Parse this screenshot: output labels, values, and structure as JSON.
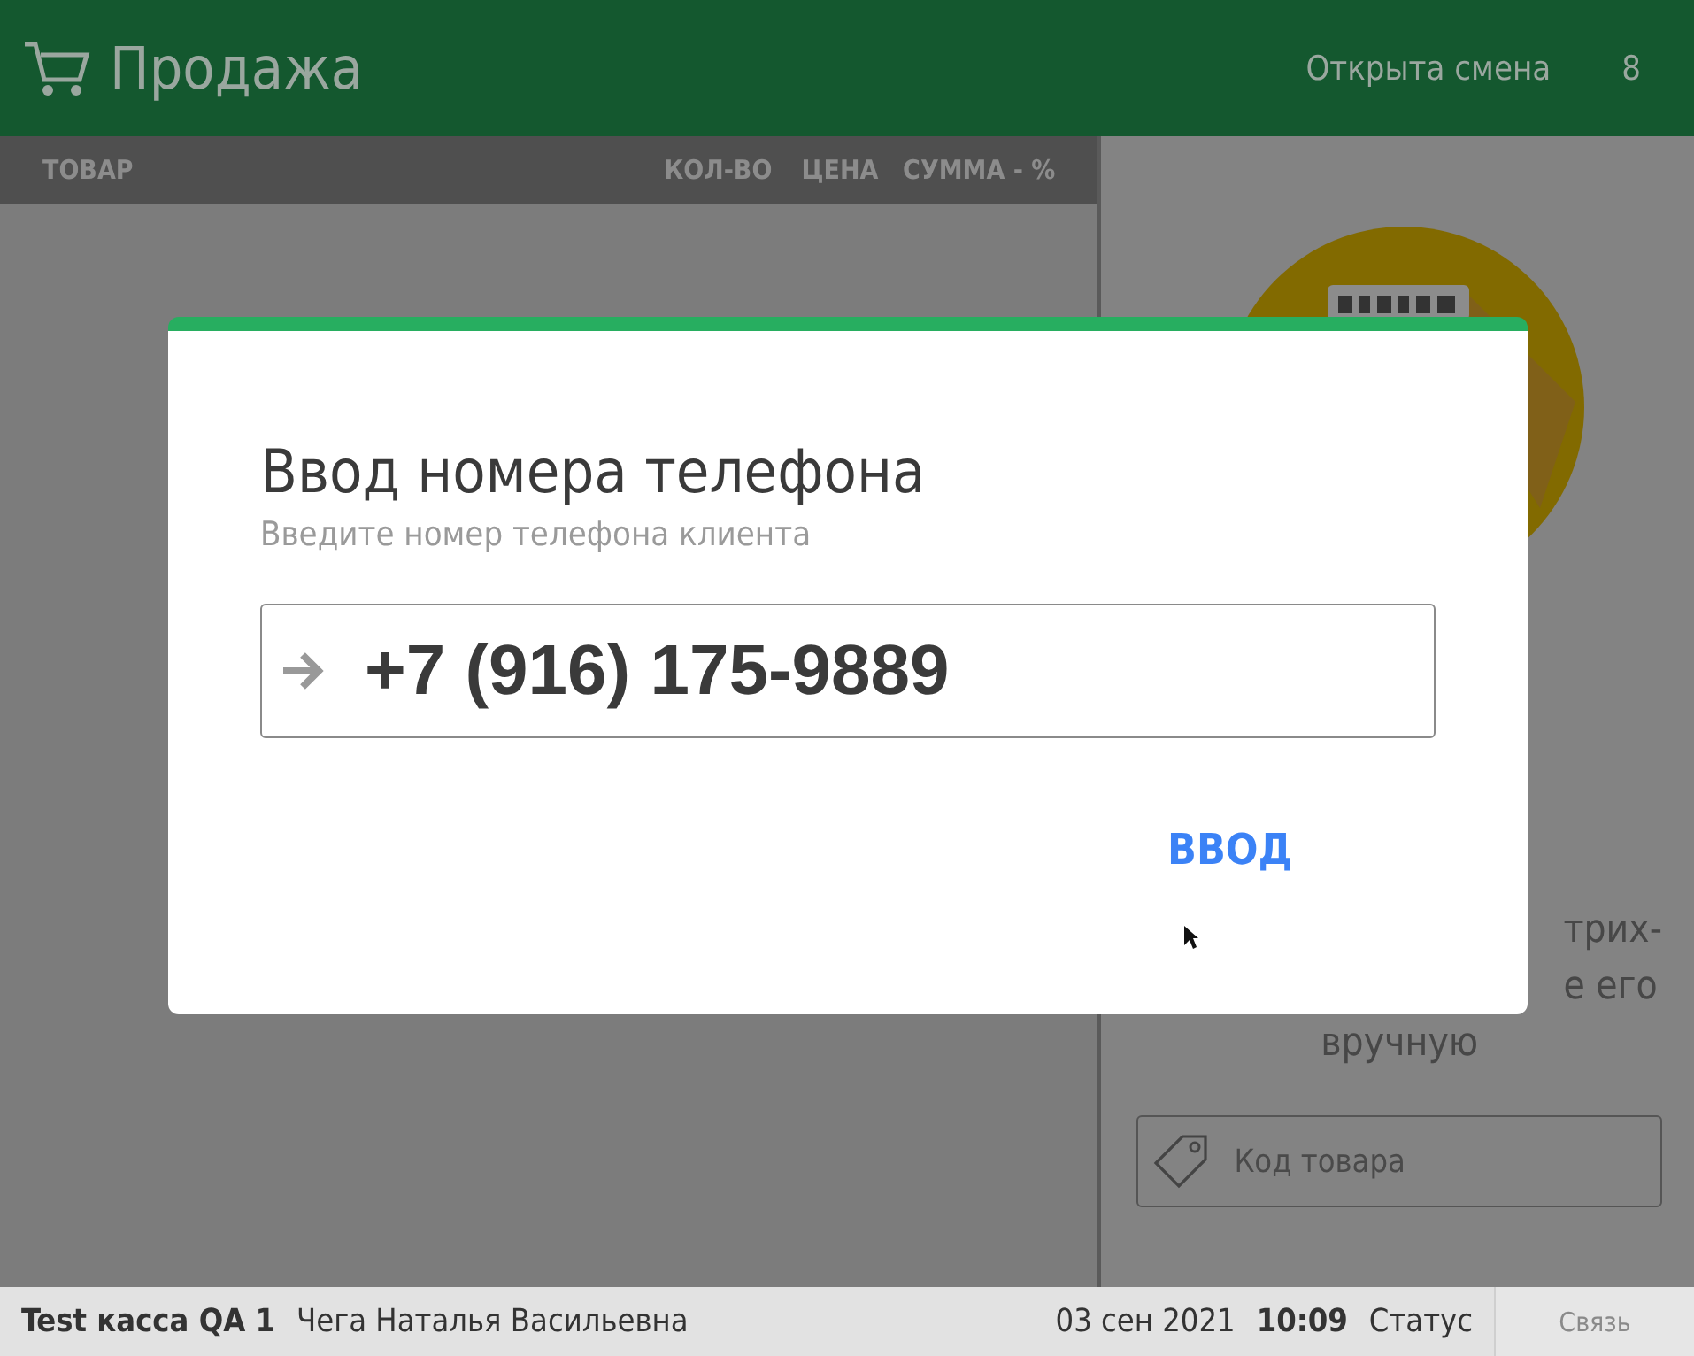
{
  "header": {
    "title": "Продажа",
    "shift_status": "Открыта смена",
    "shift_number": "8"
  },
  "table": {
    "columns": [
      "ТОВАР",
      "КОЛ-ВО",
      "ЦЕНА",
      "СУММА - %"
    ]
  },
  "scanner_panel": {
    "hint_lines": [
      "трих-",
      "е его",
      "вручную"
    ],
    "code_field": {
      "placeholder": "Код товара"
    }
  },
  "dialog": {
    "title": "Ввод номера телефона",
    "subtitle": "Введите номер телефона клиента",
    "phone": "+7 (916) 175-9889",
    "button": "ВВОД"
  },
  "status_bar": {
    "register": "Test касса QA 1",
    "cashier": "Чега Наталья Васильевна",
    "date": "03 сен 2021",
    "time": "10:09",
    "status": "Статус",
    "connection_button": "Связь"
  }
}
